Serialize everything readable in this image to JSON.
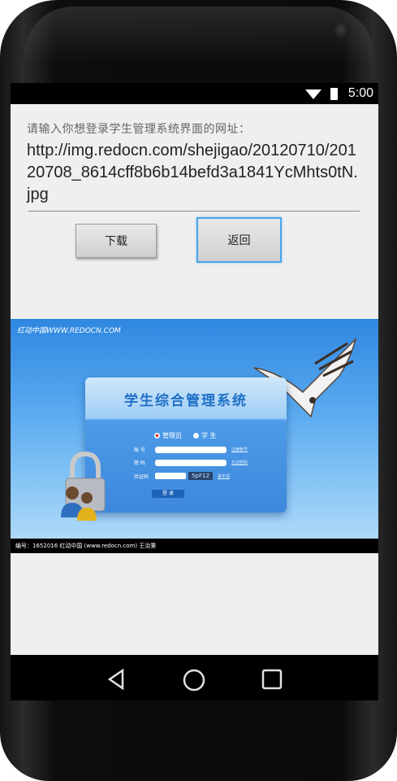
{
  "status_bar": {
    "time": "5:00"
  },
  "form": {
    "prompt": "请输入你想登录学生管理系统界面的网址：",
    "url_value": "http://img.redocn.com/shejigao/20120710/20120708_8614cff8b6b14befd3a1841YcMhts0tN.jpg",
    "download_label": "下载",
    "back_label": "返回"
  },
  "image": {
    "watermark_top": "红动中国WWW.REDOCN.COM",
    "panel_title": "学生综合管理系统",
    "role_admin": "管理员",
    "role_student": "学 生",
    "field_account": "帐 号",
    "field_password": "密 码",
    "field_captcha": "验证码",
    "link_register": "注册帐号",
    "link_forgot": "忘记密码",
    "captcha_code": "5pF12",
    "captcha_refresh": "看不清",
    "login_label": "登 录",
    "info_bar": "编号：1652016   红动中国 (www.redocn.com)   王治秉"
  },
  "colors": {
    "accent": "#4aa3e8",
    "banner_blue": "#2f87e0",
    "screen_bg": "#efefef"
  },
  "icons": [
    "wifi-icon",
    "battery-icon",
    "back-nav-icon",
    "home-nav-icon",
    "recents-nav-icon",
    "lock-icon",
    "users-icon",
    "eagle-image"
  ]
}
